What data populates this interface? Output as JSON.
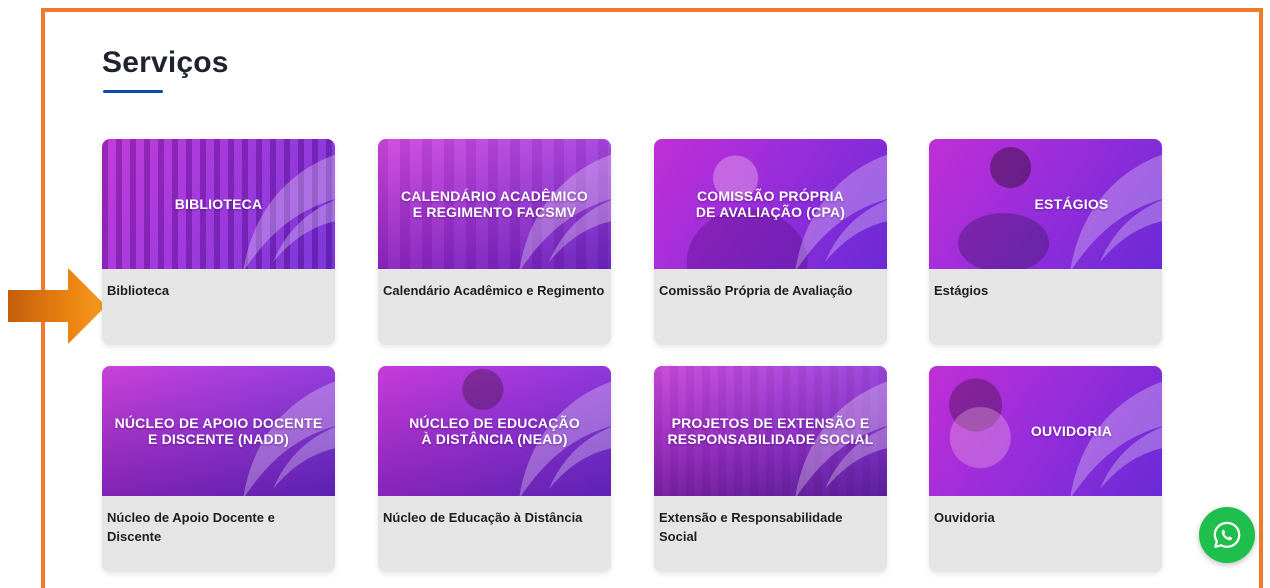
{
  "section": {
    "title": "Serviços"
  },
  "colors": {
    "frame_border": "#f07a2a",
    "title_underline": "#0b4aa8",
    "card_background": "#e5e5e5",
    "banner_gradient": [
      "#c12fd6",
      "#9a2ddb",
      "#6a2ad6"
    ],
    "arrow": "#e07a10",
    "whatsapp": "#1fbf4e"
  },
  "cards": [
    {
      "banner": "BIBLIOTECA",
      "label": "Biblioteca",
      "icon": "library-photo"
    },
    {
      "banner": "CALENDÁRIO ACADÊMICO\nE REGIMENTO FACSMV",
      "label": "Calendário Acadêmico e Regimento",
      "icon": "library-desk-photo"
    },
    {
      "banner": "COMISSÃO PRÓPRIA\nDE AVALIAÇÃO (CPA)",
      "label": "Comissão Própria  de Avaliação",
      "icon": "woman-photo"
    },
    {
      "banner": "ESTÁGIOS",
      "label": "Estágios",
      "icon": "student-reading-photo"
    },
    {
      "banner": "NÚCLEO DE APOIO DOCENTE\nE DISCENTE (NADD)",
      "label": "Núcleo de Apoio Docente e Discente",
      "icon": "classroom-photo"
    },
    {
      "banner": "NÚCLEO DE EDUCAÇÃO\nÀ DISTÂNCIA (NEAD)",
      "label": "Núcleo de Educação à Distância",
      "icon": "laptop-woman-photo"
    },
    {
      "banner": "PROJETOS DE EXTENSÃO E\nRESPONSABILIDADE SOCIAL",
      "label": "Extensão e Responsabilidade Social",
      "icon": "community-house-photo"
    },
    {
      "banner": "OUVIDORIA",
      "label": "Ouvidoria",
      "icon": "headset-woman-photo"
    }
  ],
  "pointer": {
    "icon": "arrow-right-icon"
  },
  "chat": {
    "icon": "whatsapp-icon"
  }
}
